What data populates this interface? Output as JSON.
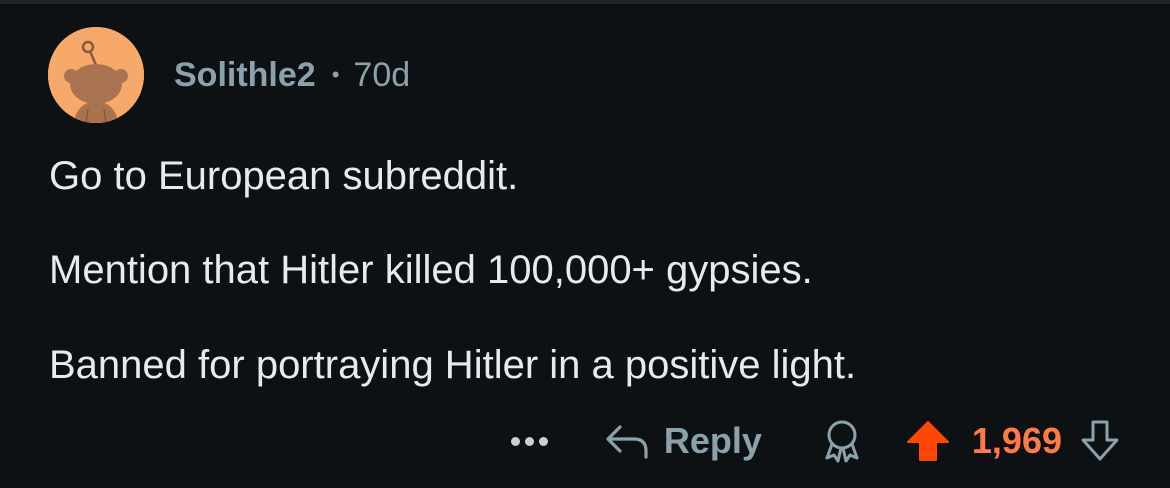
{
  "comment": {
    "author": "Solithle2",
    "separator": "•",
    "age": "70d",
    "paragraphs": [
      "Go to European subreddit.",
      "Mention that Hitler killed 100,000+ gypsies.",
      "Banned for portraying Hitler in a positive light."
    ]
  },
  "actions": {
    "more_icon": "more-horizontal-icon",
    "reply_icon": "reply-arrow-icon",
    "reply_label": "Reply",
    "award_icon": "award-icon",
    "upvote_icon": "upvote-arrow-icon",
    "score": "1,969",
    "downvote_icon": "downvote-arrow-icon"
  },
  "colors": {
    "background": "#0e1113",
    "avatar_bg": "#f6a96a",
    "meta_text": "#8ba2ad",
    "body_text": "#e4ecf0",
    "upvote_active": "#ff4500",
    "score_active": "#ff7a45"
  }
}
